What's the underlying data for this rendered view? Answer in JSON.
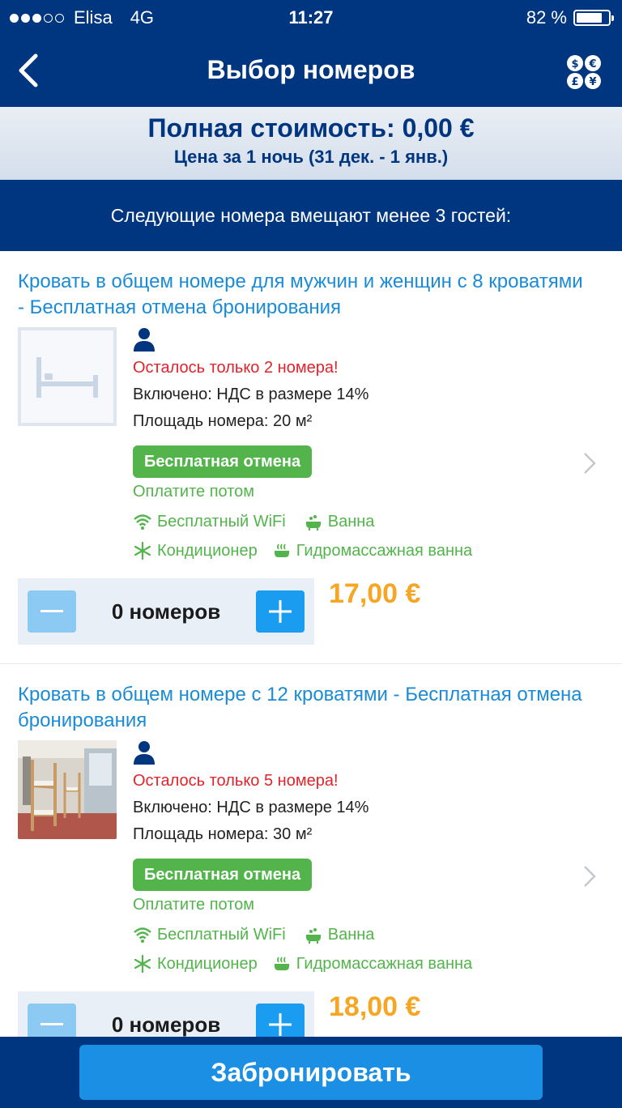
{
  "status_bar": {
    "carrier": "Elisa",
    "network": "4G",
    "time": "11:27",
    "battery_text": "82 %",
    "battery_level": 0.82
  },
  "nav": {
    "title": "Выбор номеров",
    "back_icon": "chevron-left-icon",
    "currency_icon": "currency-switch-icon"
  },
  "summary": {
    "total": "Полная стоимость: 0,00 €",
    "per_night": "Цена за 1 ночь (31 дек. - 1 янв.)"
  },
  "notice": "Следующие номера вмещают менее 3 гостей:",
  "rooms": [
    {
      "title": "Кровать в общем номере для мужчин и женщин с 8 кроватями - Бесплатная отмена бронирования",
      "availability": "Осталось только 2 номера!",
      "included": "Включено: НДС в размере 14%",
      "area": "Площадь номера: 20 м²",
      "free_cancel": "Бесплатная отмена",
      "pay_later": "Оплатите потом",
      "facilities": [
        "Бесплатный WiFi",
        "Ванна",
        "Кондиционер",
        "Гидромассажная ванна"
      ],
      "count_label": "0 номеров",
      "price": "17,00 €"
    },
    {
      "title": "Кровать в общем номере с 12 кроватями  - Бесплатная отмена бронирования",
      "availability": "Осталось только 5 номера!",
      "included": "Включено: НДС в размере 14%",
      "area": "Площадь номера: 30 м²",
      "free_cancel": "Бесплатная отмена",
      "pay_later": "Оплатите потом",
      "facilities": [
        "Бесплатный WiFi",
        "Ванна",
        "Кондиционер",
        "Гидромассажная ванна"
      ],
      "count_label": "0 номеров",
      "price": "18,00 €"
    }
  ],
  "book_button": "Забронировать",
  "colors": {
    "brand": "#003580",
    "link": "#1a8bd6",
    "warning": "#e0242b",
    "success": "#52b44b",
    "price": "#f5a623",
    "button": "#1a8fe3"
  }
}
